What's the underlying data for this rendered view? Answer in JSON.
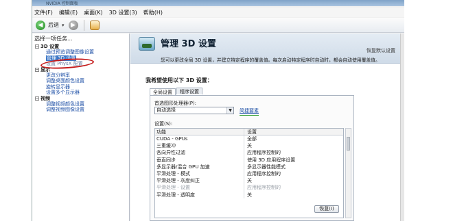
{
  "window": {
    "title": "NVIDIA 控制面板"
  },
  "menu": [
    "文件(F)",
    "编辑(E)",
    "桌面(K)",
    "3D 设置(3)",
    "帮助(H)"
  ],
  "toolbar": {
    "back_label": "后退",
    "back_drop": "▾"
  },
  "left": {
    "header": "选择一项任务...",
    "tree": [
      {
        "type": "cat",
        "label": "3D 设置"
      },
      {
        "type": "child",
        "label": "通过预览调整图像设置"
      },
      {
        "type": "child",
        "label": "管理 3D 设置",
        "selected": true
      },
      {
        "type": "child",
        "label": "设置 PhysX 配置",
        "dim": true
      },
      {
        "type": "cat",
        "label": "显示"
      },
      {
        "type": "child",
        "label": "更改分辨率"
      },
      {
        "type": "child",
        "label": "调整桌面颜色设置"
      },
      {
        "type": "child",
        "label": "旋转显示器"
      },
      {
        "type": "child",
        "label": "设置多个显示器"
      },
      {
        "type": "cat",
        "label": "视频"
      },
      {
        "type": "child",
        "label": "调整视频颜色设置"
      },
      {
        "type": "child",
        "label": "调整视频图像设置"
      }
    ]
  },
  "main": {
    "title": "管理 3D 设置",
    "restore_defaults": "恢复默认设置",
    "description": "您可以更改全局 3D 设置，并建立特定程序的覆盖值。每次启动特定程序时自动时，都会自动使用覆盖值。",
    "question": "我希望使用以下 3D 设置：",
    "tabs": [
      "全局设置",
      "程序设置"
    ],
    "preferred_label": "首选图形处理器(P):",
    "preferred_value": "自动选择",
    "help_link": "简捷要素",
    "settings_label": "设置(S):",
    "columns": [
      "功能",
      "设置"
    ],
    "rows": [
      [
        "CUDA - GPUs",
        "全部",
        false
      ],
      [
        "三重缓冲",
        "关",
        false
      ],
      [
        "各向异性过滤",
        "应用程序控制的",
        false
      ],
      [
        "垂直同步",
        "使用 3D 应用程序设置",
        false
      ],
      [
        "多显示器/混合 GPU 加速",
        "多显示器性能模式",
        false
      ],
      [
        "平滑处理 - 模式",
        "应用程序控制的",
        false
      ],
      [
        "平滑处理 - 灰度纠正",
        "关",
        false
      ],
      [
        "平滑处理 - 设置",
        "应用程序控制的",
        true
      ],
      [
        "平滑处理 - 透明度",
        "关",
        false
      ]
    ],
    "restore_button": "恢复(I)"
  }
}
